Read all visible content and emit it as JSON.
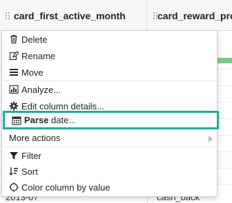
{
  "table": {
    "columns": [
      {
        "name": "card_first_active_month"
      },
      {
        "name": "card_reward_prog"
      }
    ],
    "last_row": {
      "col1": "2013-07",
      "col2": "cash_back"
    }
  },
  "context_menu": {
    "items": [
      {
        "label": "Delete",
        "icon": "trash-icon"
      },
      {
        "label": "Rename",
        "icon": "edit-icon"
      },
      {
        "label": "Move",
        "icon": "menu-lines-icon"
      },
      {
        "label": "Analyze...",
        "icon": "bar-chart-icon"
      },
      {
        "label": "Edit column details...",
        "icon": "gear-icon"
      },
      {
        "label_bold": "Parse",
        "label_rest": " date...",
        "icon": "calendar-icon",
        "highlighted": true
      },
      {
        "label": "More actions",
        "has_submenu": true
      },
      {
        "label": "Filter",
        "icon": "funnel-icon"
      },
      {
        "label": "Sort",
        "icon": "sort-icon"
      },
      {
        "label": "Color column by value",
        "icon": "palette-icon"
      }
    ]
  },
  "colors": {
    "highlight_border": "#1aada1",
    "bar_fill": "#7cc98b"
  }
}
